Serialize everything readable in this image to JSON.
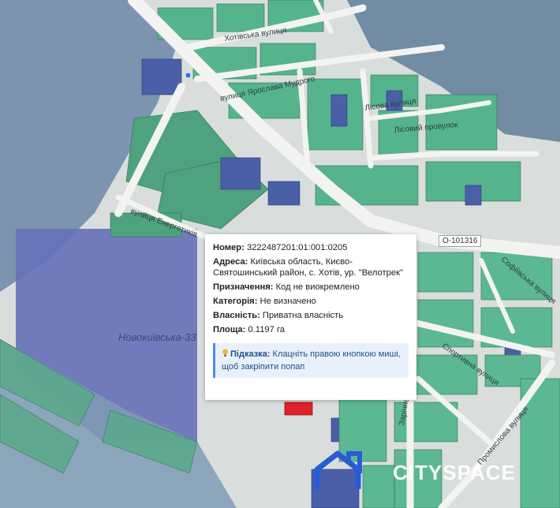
{
  "map": {
    "streets": [
      "Хотівська вулиця",
      "вулиця Ярослава Мудрого",
      "Лісова вулиця",
      "Лісовий провулок",
      "вулиця Енергетиків",
      "Спортивна вулиця",
      "Софіївська вулиця",
      "Промислова вулиця",
      "Зарічна"
    ],
    "district_label": "Новокиївська-33",
    "road_code": "О-101316",
    "brand": "CITYSPACE",
    "colors": {
      "parcel_green": "#4fae82",
      "parcel_blue": "#5066b0",
      "selected_parcel": "#e0202a",
      "road": "#f3f4f2"
    }
  },
  "popup": {
    "number_label": "Номер:",
    "number_value": "3222487201:01:001:0205",
    "address_label": "Адреса:",
    "address_value": "Київська область, Києво-Святошинський район, с. Хотів, ур. \"Велотрек\"",
    "purpose_label": "Призначення:",
    "purpose_value": "Код не виокремлено",
    "category_label": "Категорія:",
    "category_value": "Не визначено",
    "ownership_label": "Власність:",
    "ownership_value": "Приватна власність",
    "area_label": "Площа:",
    "area_value": "0.1197 га",
    "hint_label": "Підказка:",
    "hint_text": "Клацніть правою кнопкою миші, щоб закріпити попап",
    "hint_icon": "lightbulb-icon"
  }
}
